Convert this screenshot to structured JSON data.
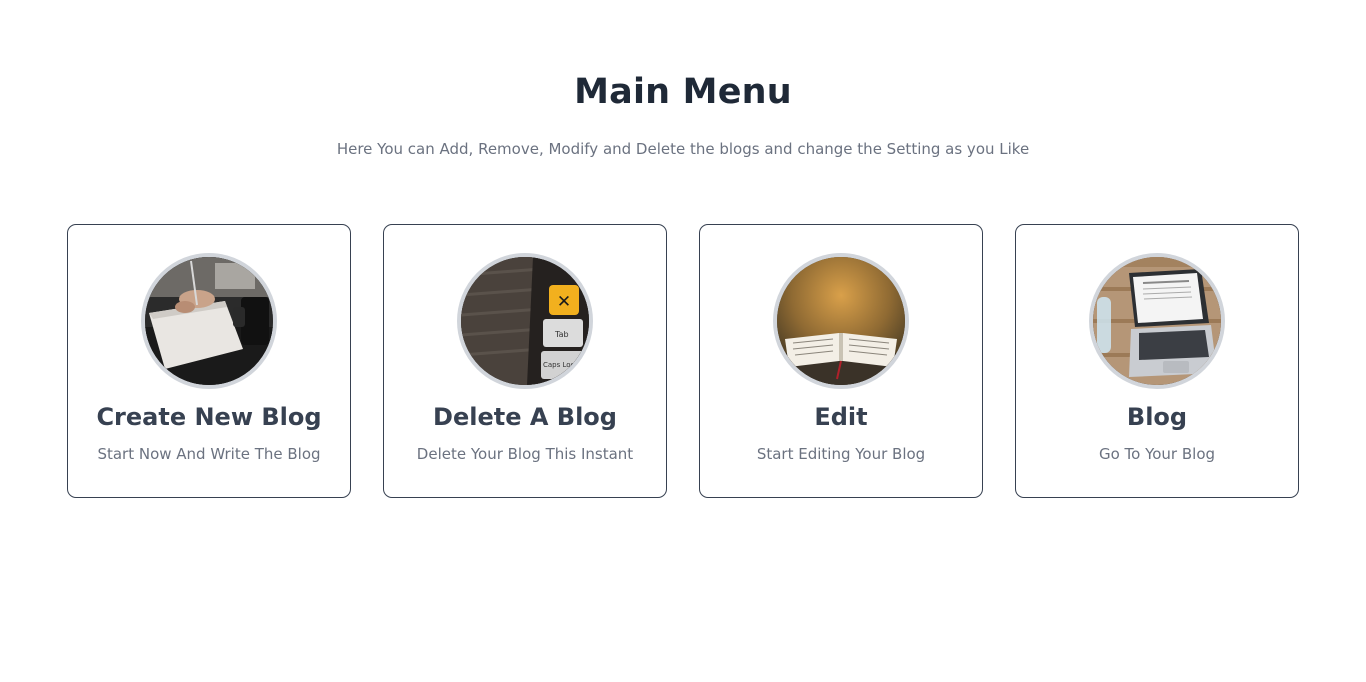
{
  "header": {
    "title": "Main Menu",
    "subtitle": "Here You can Add, Remove, Modify and Delete the blogs and change the Setting as you Like"
  },
  "cards": [
    {
      "title": "Create New Blog",
      "description": "Start Now And Write The Blog",
      "image": "hand-writing-notebook-photo"
    },
    {
      "title": "Delete A Blog",
      "description": "Delete Your Blog This Instant",
      "image": "keyboard-delete-key-photo",
      "key_labels": [
        "Tab",
        "Caps Lock"
      ]
    },
    {
      "title": "Edit",
      "description": "Start Editing Your Blog",
      "image": "open-book-photo"
    },
    {
      "title": "Blog",
      "description": "Go To Your Blog",
      "image": "laptop-on-wooden-desk-photo"
    }
  ],
  "colors": {
    "heading": "#1f2937",
    "muted_text": "#6b7280",
    "card_border": "#374151",
    "thumb_ring": "#d1d5db",
    "delete_key": "#f2b01e"
  }
}
